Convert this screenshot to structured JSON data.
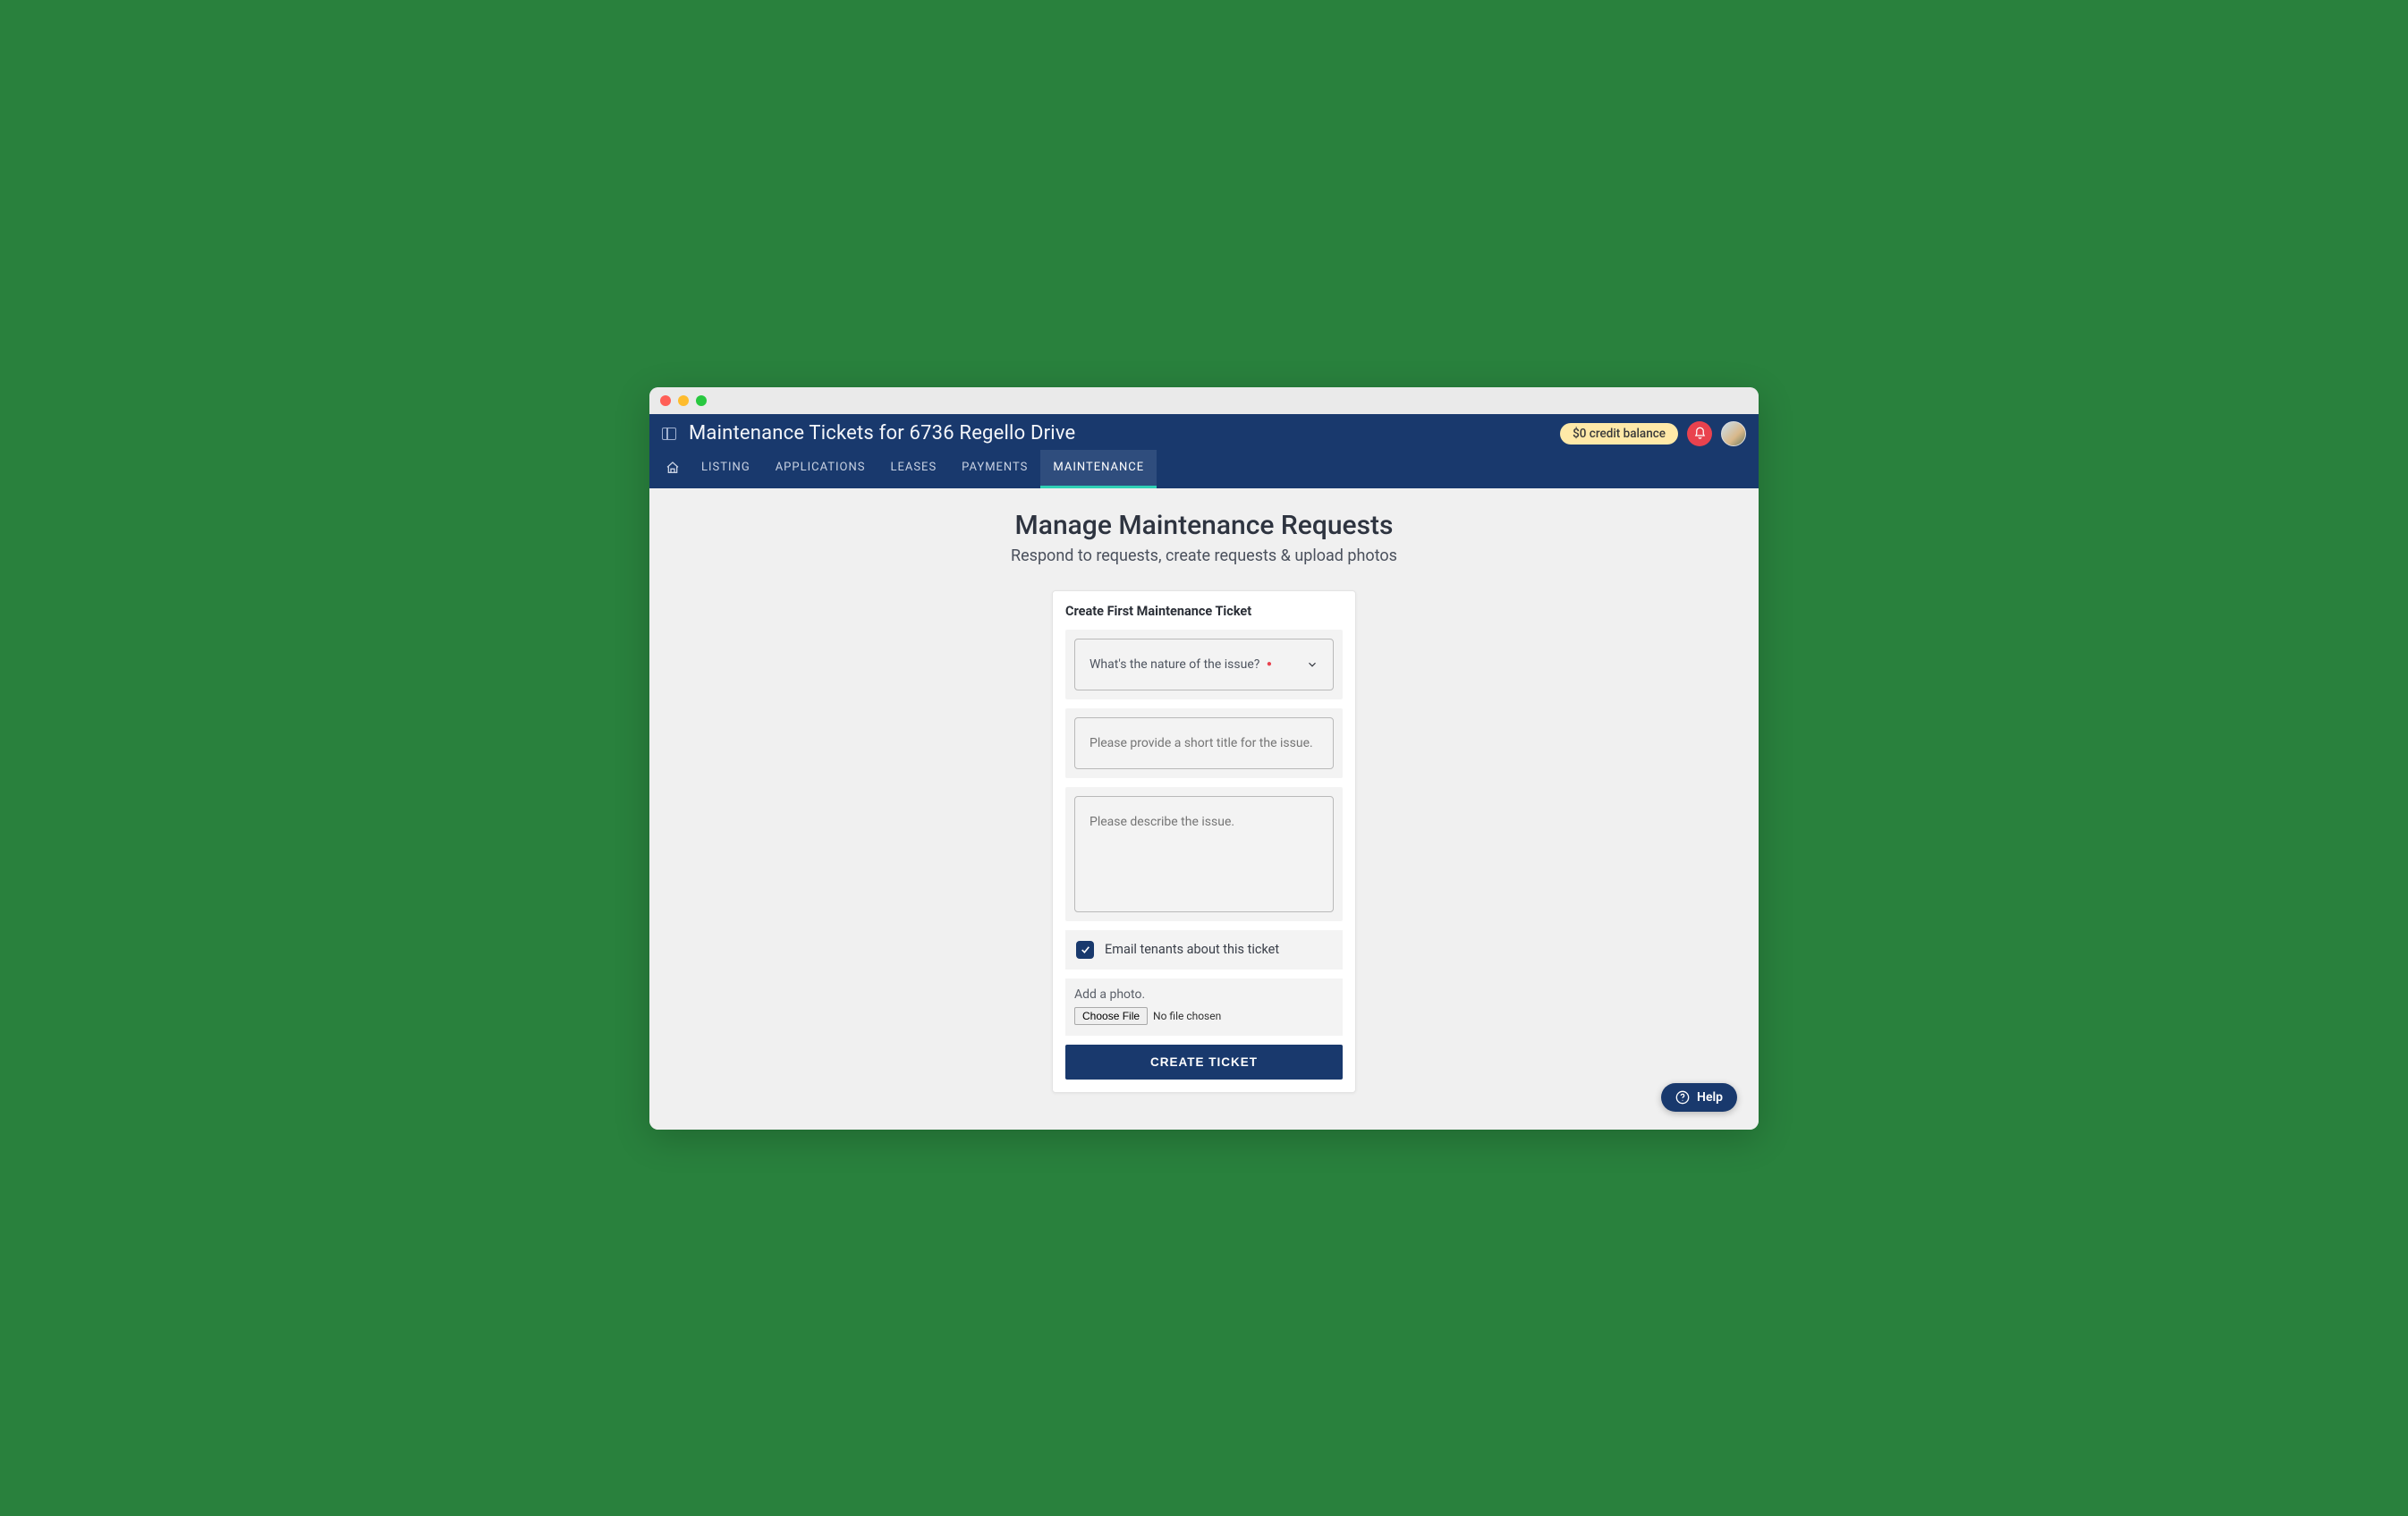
{
  "header": {
    "title": "Maintenance Tickets for 6736 Regello Drive",
    "credit_label": "$0 credit balance"
  },
  "tabs": {
    "listing": "LISTING",
    "applications": "APPLICATIONS",
    "leases": "LEASES",
    "payments": "PAYMENTS",
    "maintenance": "MAINTENANCE"
  },
  "main": {
    "heading": "Manage Maintenance Requests",
    "subheading": "Respond to requests, create requests & upload photos"
  },
  "form": {
    "card_title": "Create First Maintenance Ticket",
    "nature_placeholder": "What's the nature of the issue?",
    "title_placeholder": "Please provide a short title for the issue.",
    "describe_placeholder": "Please describe the issue.",
    "email_checkbox_label": "Email tenants about this ticket",
    "email_checked": true,
    "photo_label": "Add a photo.",
    "choose_file_label": "Choose File",
    "no_file_label": "No file chosen",
    "submit_label": "CREATE TICKET"
  },
  "help": {
    "label": "Help"
  }
}
